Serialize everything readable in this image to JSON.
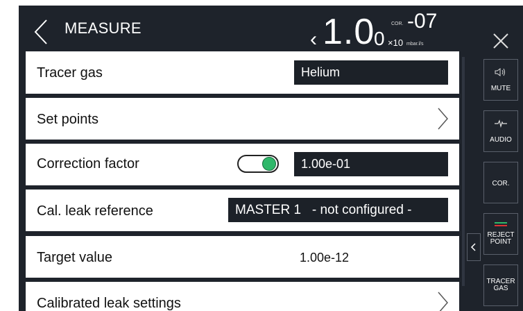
{
  "header": {
    "title": "MEASURE",
    "reading": {
      "prefix": "‹",
      "main": "1.0",
      "digit": "0",
      "cor": "COR.",
      "exponent": "-07",
      "multiplier": "×10",
      "unit": "mbar.l/s"
    }
  },
  "rows": {
    "tracer_gas": {
      "label": "Tracer gas",
      "value": "Helium"
    },
    "set_points": {
      "label": "Set points"
    },
    "correction_factor": {
      "label": "Correction factor",
      "value": "1.00e-01",
      "toggle_on": true
    },
    "cal_leak_reference": {
      "label": "Cal. leak reference",
      "value": "MASTER 1   - not configured -"
    },
    "target_value": {
      "label": "Target value",
      "value": "1.00e-12"
    },
    "calibrated_leak_settings": {
      "label": "Calibrated leak settings"
    }
  },
  "side_panel": {
    "mute": "MUTE",
    "audio": "AUDIO",
    "cor": "COR.",
    "reject_point_1": "REJECT",
    "reject_point_2": "POINT",
    "tracer_gas_1": "TRACER",
    "tracer_gas_2": "GAS"
  },
  "colors": {
    "background": "#1e232b",
    "row": "#ffffff",
    "toggle_on": "#2fb86a",
    "value_box": "#1c2128"
  }
}
